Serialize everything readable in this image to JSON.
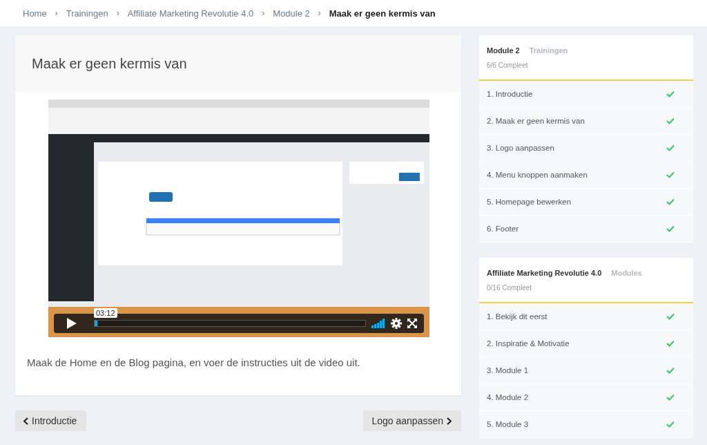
{
  "breadcrumb": [
    {
      "label": "Home",
      "current": false
    },
    {
      "label": "Trainingen",
      "current": false
    },
    {
      "label": "Affiliate Marketing Revolutie 4.0",
      "current": false
    },
    {
      "label": "Module 2",
      "current": false
    },
    {
      "label": "Maak er geen kermis van",
      "current": true
    }
  ],
  "breadcrumb_separator": "›",
  "lesson": {
    "title": "Maak er geen kermis van",
    "video": {
      "time": "03:12",
      "level": 0.01
    },
    "description": "Maak de Home en de Blog pagina, en voer de instructies uit de video uit."
  },
  "navigation": [
    {
      "kind": "previous",
      "label": "Introductie"
    },
    {
      "kind": "next",
      "label": "Logo aanpassen"
    }
  ],
  "sidebar": [
    {
      "title": "Module 2",
      "subtitle": "Trainingen",
      "progress": "6/6 Compleet",
      "items": [
        {
          "label": "1. Introductie",
          "done": true
        },
        {
          "label": "2. Maak er geen kermis van",
          "done": true
        },
        {
          "label": "3. Logo aanpassen",
          "done": true
        },
        {
          "label": "4. Menu knoppen aanmaken",
          "done": true
        },
        {
          "label": "5. Homepage bewerken",
          "done": true
        },
        {
          "label": "6. Footer",
          "done": true
        }
      ]
    },
    {
      "title": "Affiliate Marketing Revolutie 4.0",
      "subtitle": "Modules",
      "progress": "0/16 Compleet",
      "items": [
        {
          "label": "1. Bekijk dit eerst",
          "done": true
        },
        {
          "label": "2. Inspiratie & Motivatie",
          "done": true
        },
        {
          "label": "3. Module 1",
          "done": true
        },
        {
          "label": "4. Module 2",
          "done": true
        },
        {
          "label": "5. Module 3",
          "done": true
        }
      ]
    }
  ]
}
